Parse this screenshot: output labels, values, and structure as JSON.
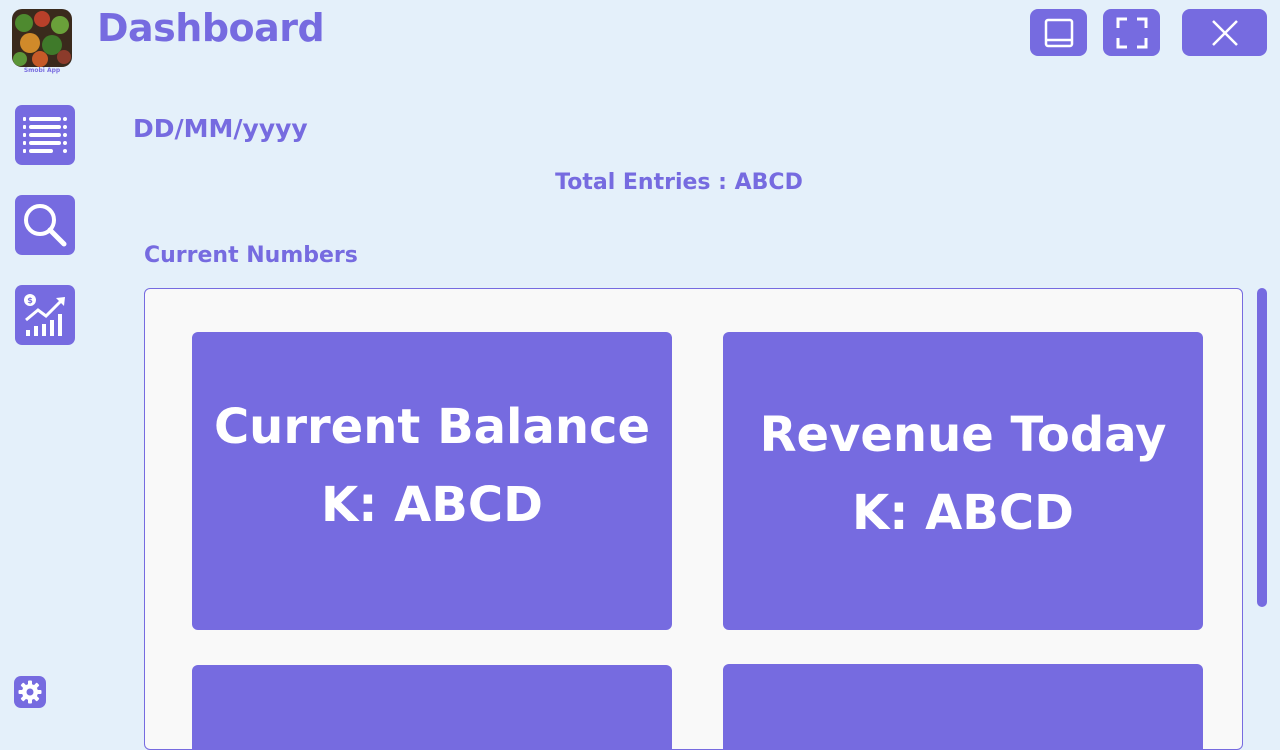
{
  "app": {
    "logo_caption": "Smobi App",
    "title": "Dashboard"
  },
  "window_controls": {
    "minimize": "minimize-icon",
    "fullscreen": "fullscreen-icon",
    "close": "close-icon"
  },
  "sidebar": {
    "items": [
      {
        "icon": "list-icon"
      },
      {
        "icon": "search-icon"
      },
      {
        "icon": "chart-growth-icon"
      }
    ],
    "settings_icon": "gear-icon"
  },
  "main": {
    "date": "DD/MM/yyyy",
    "total_entries": "Total Entries : ABCD",
    "section_label": "Current Numbers",
    "cards": [
      {
        "title": "Current Balance",
        "value": "K: ABCD"
      },
      {
        "title": "Revenue Today",
        "value": "K: ABCD"
      }
    ]
  },
  "colors": {
    "accent": "#766be0",
    "background": "#e4f0fa",
    "panel": "#f9f9f9"
  }
}
